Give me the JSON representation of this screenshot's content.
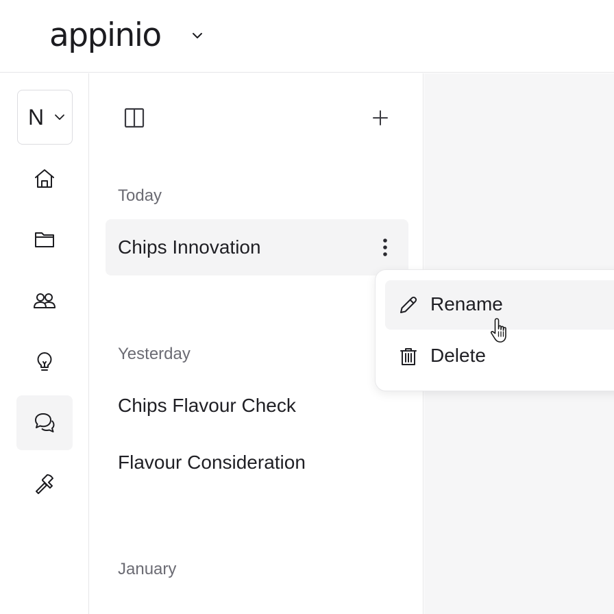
{
  "header": {
    "logo_text": "appinio"
  },
  "workspace": {
    "letter": "N"
  },
  "rail": {
    "items": [
      {
        "icon": "home-icon"
      },
      {
        "icon": "folder-icon"
      },
      {
        "icon": "users-icon"
      },
      {
        "icon": "lightbulb-icon"
      },
      {
        "icon": "chat-icon",
        "active": true
      },
      {
        "icon": "hammer-icon"
      }
    ]
  },
  "chat_list": {
    "sections": [
      {
        "label": "Today",
        "items": [
          "Chips Innovation"
        ]
      },
      {
        "label": "Yesterday",
        "items": [
          "Chips Flavour Check",
          "Flavour Consideration"
        ]
      },
      {
        "label": "January",
        "items": []
      }
    ]
  },
  "context_menu": {
    "items": [
      {
        "label": "Rename",
        "icon": "pencil-icon"
      },
      {
        "label": "Delete",
        "icon": "trash-icon"
      }
    ]
  },
  "colors": {
    "active_bg": "#f4f4f5",
    "text": "#1f1f24",
    "muted_text": "#6b6b73",
    "border": "#e6e6e8",
    "main_bg": "#f6f6f7"
  }
}
